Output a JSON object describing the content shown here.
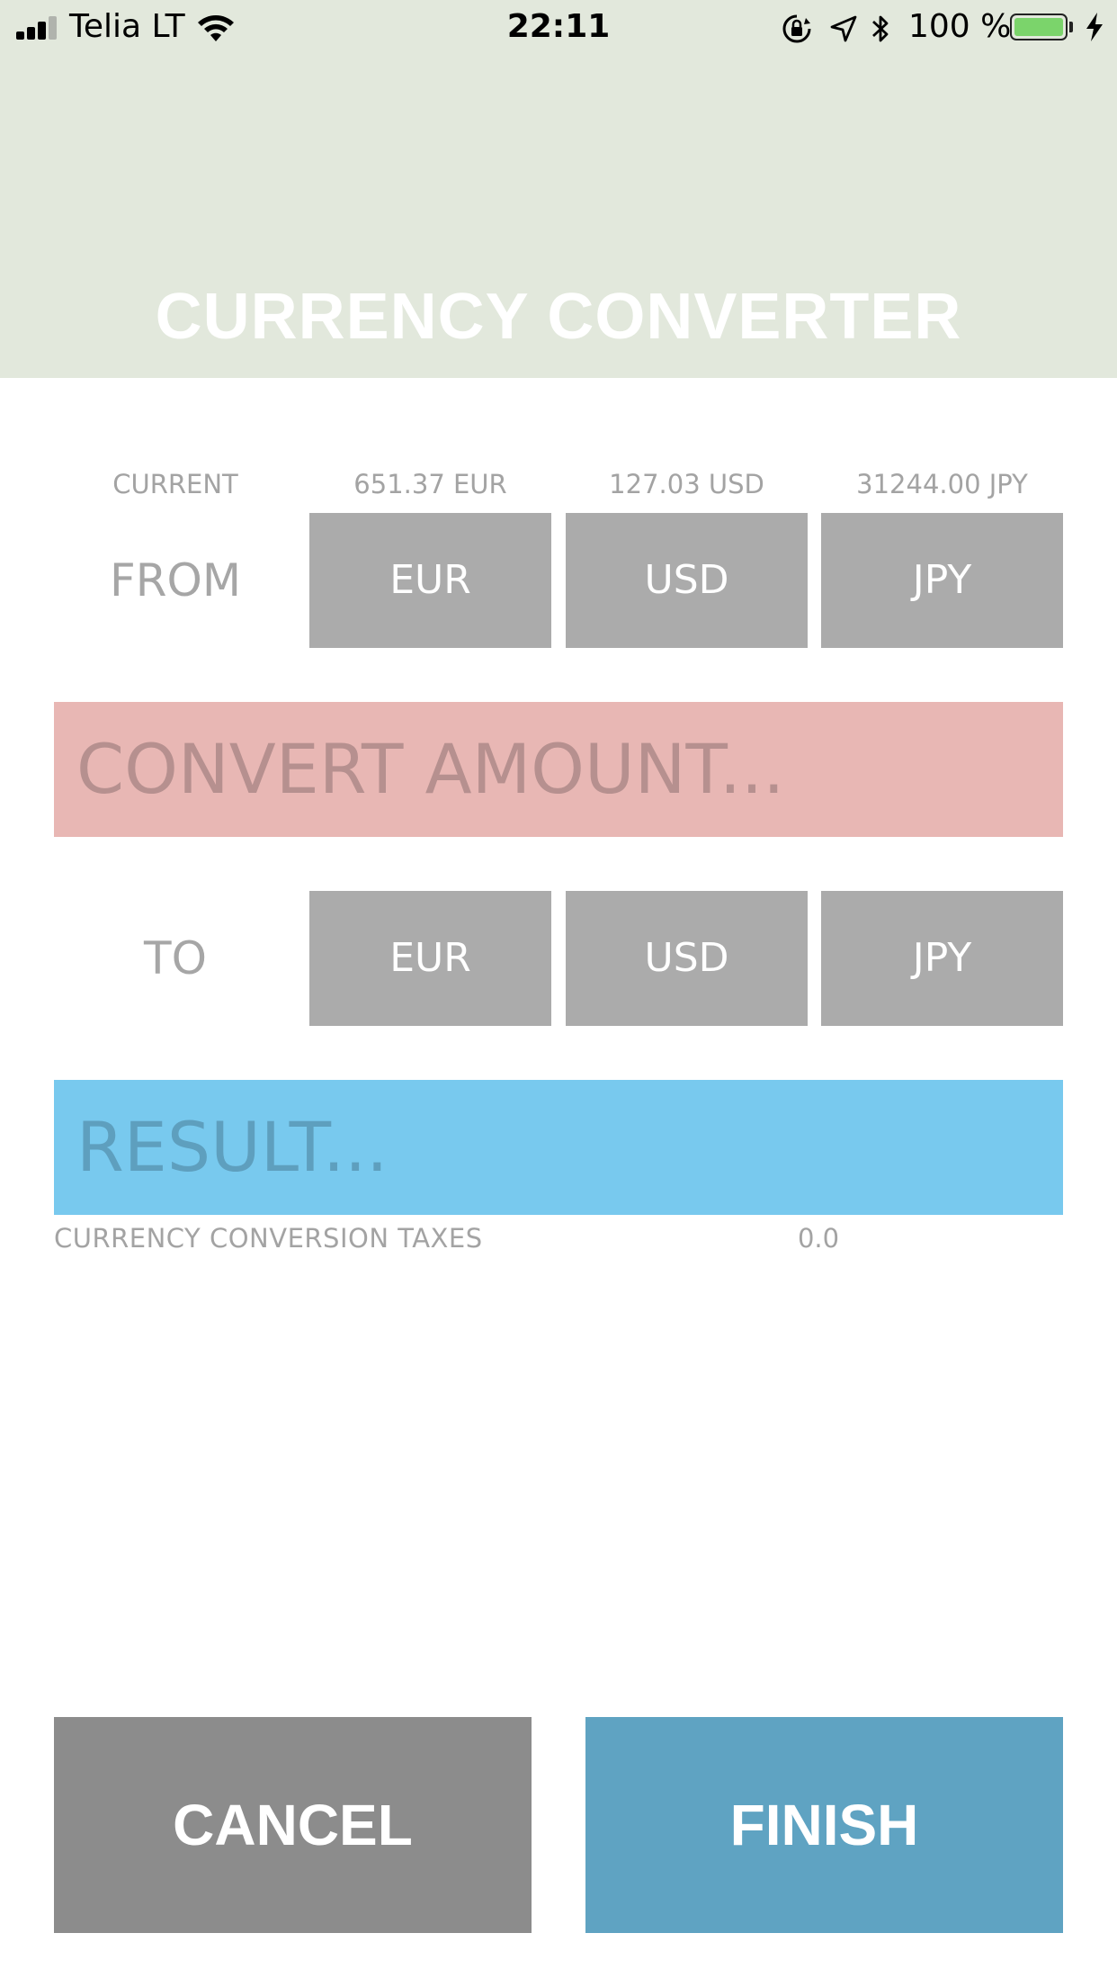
{
  "status_bar": {
    "carrier": "Telia LT",
    "time": "22:11",
    "battery_percent": "100 %",
    "battery_level": 1.0,
    "signal_bars": 3,
    "icons": [
      "cellular-signal-icon",
      "wifi-icon",
      "orientation-lock-icon",
      "location-icon",
      "bluetooth-icon",
      "battery-icon",
      "charging-icon"
    ]
  },
  "header": {
    "title": "CURRENCY CONVERTER",
    "background": "#e2e8dc"
  },
  "balances": {
    "label": "CURRENT",
    "items": [
      "651.37 EUR",
      "127.03 USD",
      "31244.00 JPY"
    ]
  },
  "from_row": {
    "label": "FROM",
    "options": [
      "EUR",
      "USD",
      "JPY"
    ]
  },
  "amount_field": {
    "placeholder": "CONVERT AMOUNT...",
    "background": "#e8b7b4"
  },
  "to_row": {
    "label": "TO",
    "options": [
      "EUR",
      "USD",
      "JPY"
    ]
  },
  "result_field": {
    "placeholder": "RESULT...",
    "background": "#78c9ee"
  },
  "taxes": {
    "label": "CURRENCY CONVERSION TAXES",
    "value": "0.0"
  },
  "actions": {
    "cancel_label": "CANCEL",
    "finish_label": "FINISH",
    "cancel_color": "#8c8c8c",
    "finish_color": "#5fa3c2"
  }
}
